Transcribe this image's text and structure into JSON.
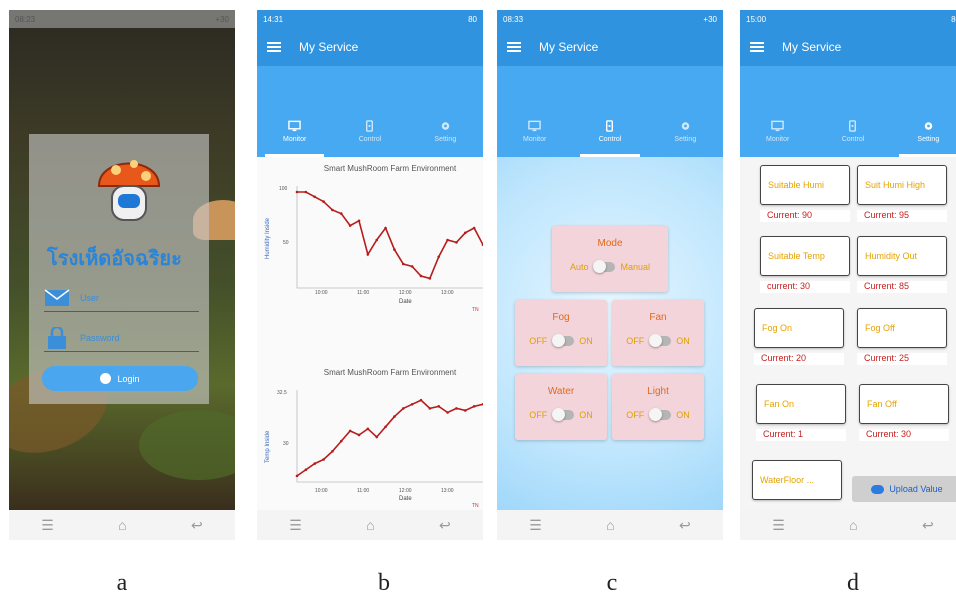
{
  "captions": [
    "a",
    "b",
    "c",
    "d"
  ],
  "phone_a": {
    "status": {
      "time": "08:23",
      "battery": "+30"
    },
    "app_name": "โรงเห็ดอัจฉริยะ",
    "user_placeholder": "User",
    "password_placeholder": "Password",
    "login_label": "Login"
  },
  "phone_b": {
    "status": {
      "time": "14:31",
      "battery": "80"
    },
    "toolbar_title": "My Service",
    "tabs": [
      {
        "label": "Monitor",
        "icon": "monitor-icon"
      },
      {
        "label": "Control",
        "icon": "phone-icon"
      },
      {
        "label": "Setting",
        "icon": "gear-icon"
      }
    ],
    "charts": [
      {
        "title": "Smart MushRoom Farm Environment",
        "ylabel": "Humidity Inside",
        "xlabel": "Date",
        "yticks": [
          "100",
          "50"
        ],
        "xticks": [
          "10:00",
          "11:00",
          "12:00",
          "13:00"
        ],
        "corner": "TN"
      },
      {
        "title": "Smart MushRoom Farm Environment",
        "ylabel": "Temp Inside",
        "xlabel": "Date",
        "yticks": [
          "32.5",
          "30"
        ],
        "xticks": [
          "10:00",
          "11:00",
          "12:00",
          "13:00"
        ],
        "corner": "TN"
      }
    ]
  },
  "chart_data": [
    {
      "type": "line",
      "title": "Smart MushRoom Farm Environment",
      "xlabel": "Date",
      "ylabel": "Humidity Inside",
      "x": [
        "09:30",
        "09:45",
        "10:00",
        "10:15",
        "10:30",
        "10:45",
        "11:00",
        "11:10",
        "11:20",
        "11:30",
        "11:40",
        "11:50",
        "12:00",
        "12:10",
        "12:20",
        "12:30",
        "12:40",
        "12:50",
        "13:00",
        "13:10",
        "13:20",
        "13:30"
      ],
      "values": [
        100,
        100,
        96,
        92,
        85,
        82,
        72,
        76,
        48,
        60,
        70,
        52,
        40,
        38,
        30,
        28,
        46,
        60,
        58,
        66,
        70,
        56
      ],
      "ylim": [
        20,
        105
      ],
      "color": "#b71c1c"
    },
    {
      "type": "line",
      "title": "Smart MushRoom Farm Environment",
      "xlabel": "Date",
      "ylabel": "Temp Inside",
      "x": [
        "09:30",
        "09:45",
        "10:00",
        "10:15",
        "10:30",
        "10:45",
        "11:00",
        "11:10",
        "11:20",
        "11:30",
        "11:40",
        "11:50",
        "12:00",
        "12:10",
        "12:20",
        "12:30",
        "12:40",
        "12:50",
        "13:00",
        "13:10",
        "13:20",
        "13:30"
      ],
      "values": [
        28.6,
        28.9,
        29.2,
        29.4,
        29.8,
        30.3,
        30.8,
        30.6,
        30.9,
        30.5,
        31.0,
        31.5,
        31.9,
        32.1,
        32.3,
        31.9,
        32.0,
        31.7,
        31.9,
        31.8,
        32.0,
        32.1
      ],
      "ylim": [
        28.3,
        32.8
      ],
      "color": "#b71c1c"
    }
  ],
  "phone_c": {
    "status": {
      "time": "08:33",
      "battery": "+30"
    },
    "toolbar_title": "My Service",
    "tabs": [
      {
        "label": "Monitor",
        "icon": "monitor-icon"
      },
      {
        "label": "Control",
        "icon": "phone-icon"
      },
      {
        "label": "Setting",
        "icon": "gear-icon"
      }
    ],
    "mode": {
      "title": "Mode",
      "left": "Auto",
      "right": "Manual"
    },
    "controls": [
      {
        "title": "Fog",
        "off": "OFF",
        "on": "ON"
      },
      {
        "title": "Fan",
        "off": "OFF",
        "on": "ON"
      },
      {
        "title": "Water",
        "off": "OFF",
        "on": "ON"
      },
      {
        "title": "Light",
        "off": "OFF",
        "on": "ON"
      }
    ]
  },
  "phone_d": {
    "status": {
      "time": "15:00",
      "battery": "80"
    },
    "toolbar_title": "My Service",
    "tabs": [
      {
        "label": "Monitor",
        "icon": "monitor-icon"
      },
      {
        "label": "Control",
        "icon": "phone-icon"
      },
      {
        "label": "Setting",
        "icon": "gear-icon"
      }
    ],
    "settings": [
      {
        "label": "Suitable Humi",
        "current": "Current: 90"
      },
      {
        "label": "Suit Humi High",
        "current": "Current: 95"
      },
      {
        "label": "Suitable Temp",
        "current": "current: 30"
      },
      {
        "label": "Humidity Out",
        "current": "Current: 85"
      },
      {
        "label": "Fog On",
        "current": "Current: 20"
      },
      {
        "label": "Fog Off",
        "current": "Current: 25"
      },
      {
        "label": "Fan On",
        "current": "Current: 1"
      },
      {
        "label": "Fan Off",
        "current": "Current: 30"
      },
      {
        "label": "WaterFloor ..."
      }
    ],
    "upload_label": "Upload Value"
  }
}
